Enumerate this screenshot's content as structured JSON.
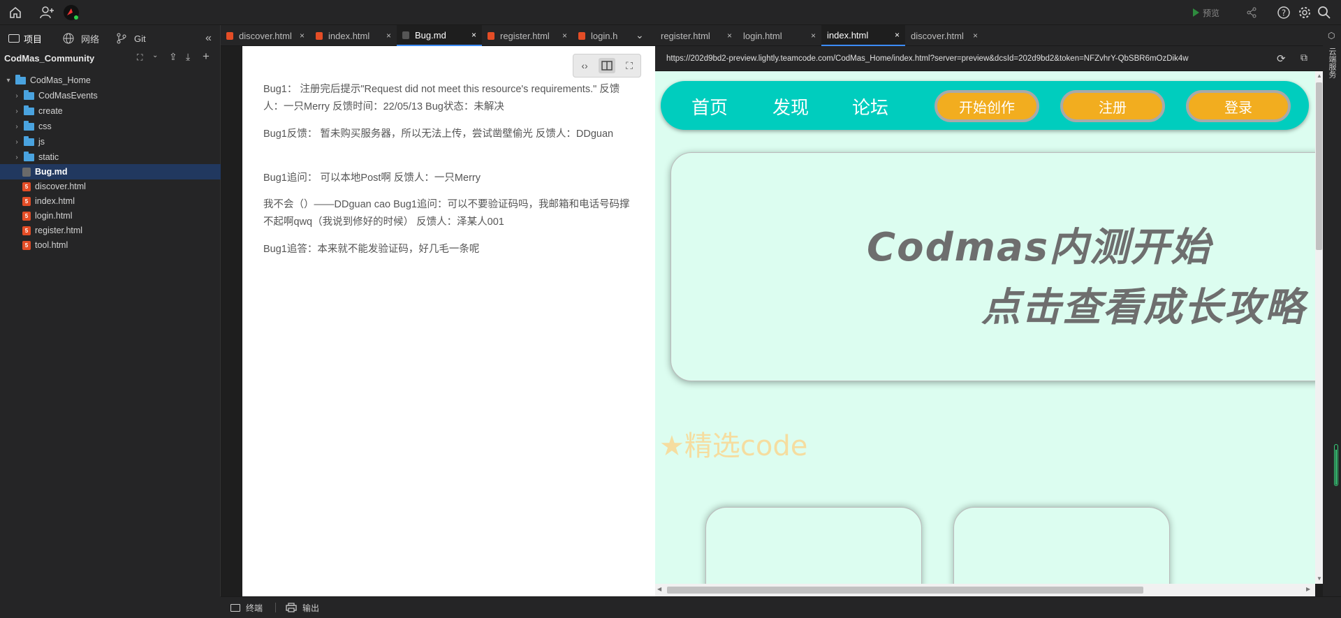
{
  "topbar": {
    "preview_label": "预览"
  },
  "sidebar": {
    "tabs": [
      {
        "label": "项目"
      },
      {
        "label": "网络"
      },
      {
        "label": "Git"
      }
    ],
    "project_name": "CodMas_Community",
    "root_folder": "CodMas_Home",
    "tree": [
      {
        "label": "CodMasEvents",
        "type": "folder"
      },
      {
        "label": "create",
        "type": "folder"
      },
      {
        "label": "css",
        "type": "folder"
      },
      {
        "label": "js",
        "type": "folder"
      },
      {
        "label": "static",
        "type": "folder"
      },
      {
        "label": "Bug.md",
        "type": "md"
      },
      {
        "label": "discover.html",
        "type": "html"
      },
      {
        "label": "index.html",
        "type": "html"
      },
      {
        "label": "login.html",
        "type": "html"
      },
      {
        "label": "register.html",
        "type": "html"
      },
      {
        "label": "tool.html",
        "type": "html"
      }
    ]
  },
  "editor_tabs": [
    {
      "label": "discover.html"
    },
    {
      "label": "index.html"
    },
    {
      "label": "Bug.md"
    },
    {
      "label": "register.html"
    },
    {
      "label": "login.h"
    }
  ],
  "preview_tabs": [
    {
      "label": "register.html"
    },
    {
      "label": "login.html"
    },
    {
      "label": "index.html"
    },
    {
      "label": "discover.html"
    }
  ],
  "markdown": {
    "paragraphs": [
      "Bug1： 注册完后提示\"Request did not meet this resource's requirements.\" 反馈人：一只Merry 反馈时间：22/05/13 Bug状态：未解决",
      "Bug1反馈： 暂未购买服务器，所以无法上传，尝试凿壁偷光 反馈人：DDguan",
      "Bug1追问： 可以本地Post啊 反馈人：一只Merry",
      "我不会（）——DDguan cao Bug1追问：可以不要验证码吗，我邮箱和电话号码撑不起啊qwq（我说到修好的时候） 反馈人：泽某人001",
      "Bug1追答：本来就不能发验证码，好几毛一条呢"
    ]
  },
  "preview": {
    "url": "https://202d9bd2-preview.lightly.teamcode.com/CodMas_Home/index.html?server=preview&dcsId=202d9bd2&token=NFZvhrY-QbSBR6mOzDik4w",
    "nav_links": [
      "首页",
      "发现",
      "论坛"
    ],
    "nav_buttons": [
      "开始创作",
      "注册",
      "登录"
    ],
    "hero_line1": "Codmas内测开始",
    "hero_line2": "点击查看成长攻略",
    "featured": "★精选code"
  },
  "right_strip_label": "云端服务",
  "bottombar": {
    "terminal": "终端",
    "output": "输出"
  }
}
